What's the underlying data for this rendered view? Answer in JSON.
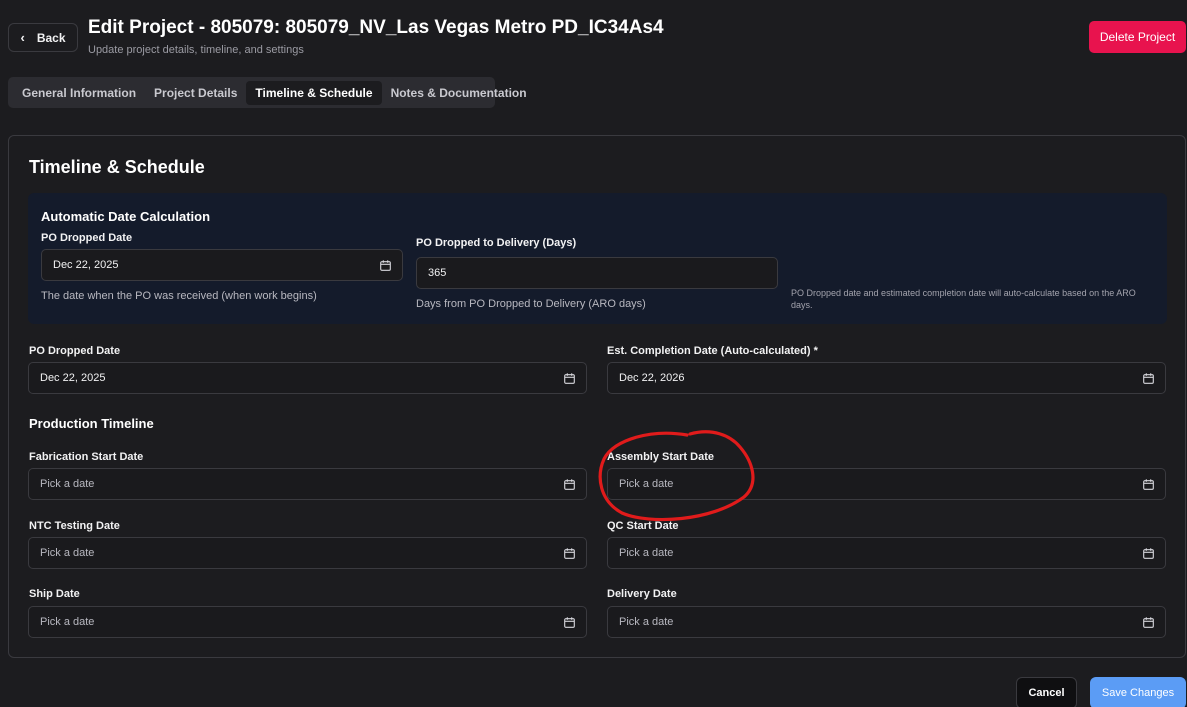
{
  "header": {
    "back_label": "Back",
    "title": "Edit Project - 805079: 805079_NV_Las Vegas Metro PD_IC34As4",
    "subtitle": "Update project details, timeline, and settings",
    "delete_label": "Delete Project"
  },
  "tabs": [
    {
      "label": "General Information",
      "active": false
    },
    {
      "label": "Project Details",
      "active": false
    },
    {
      "label": "Timeline & Schedule",
      "active": true
    },
    {
      "label": "Notes & Documentation",
      "active": false
    }
  ],
  "card": {
    "title": "Timeline & Schedule",
    "auto_calc": {
      "title": "Automatic Date Calculation",
      "po_dropped_label": "PO Dropped Date",
      "po_dropped_value": "Dec 22, 2025",
      "po_dropped_hint": "The date when the PO was received (when work begins)",
      "delivery_days_label": "PO Dropped to Delivery (Days)",
      "delivery_days_value": "365",
      "delivery_days_hint": "Days from PO Dropped to Delivery (ARO days)",
      "note": "PO Dropped date and estimated completion date will auto-calculate based on the ARO days."
    },
    "po_dropped": {
      "label": "PO Dropped Date",
      "value": "Dec 22, 2025"
    },
    "est_completion": {
      "label": "Est. Completion Date (Auto-calculated) *",
      "value": "Dec 22, 2026"
    },
    "production": {
      "title": "Production Timeline",
      "fabrication": {
        "label": "Fabrication Start Date",
        "placeholder": "Pick a date"
      },
      "assembly": {
        "label": "Assembly Start Date",
        "placeholder": "Pick a date"
      },
      "ntc": {
        "label": "NTC Testing Date",
        "placeholder": "Pick a date"
      },
      "qc": {
        "label": "QC Start Date",
        "placeholder": "Pick a date"
      },
      "ship": {
        "label": "Ship Date",
        "placeholder": "Pick a date"
      },
      "delivery": {
        "label": "Delivery Date",
        "placeholder": "Pick a date"
      }
    }
  },
  "footer": {
    "cancel_label": "Cancel",
    "save_label": "Save Changes"
  },
  "colors": {
    "background": "#1c1c1f",
    "delete": "#e8134e",
    "save": "#5b9cf5",
    "auto_box": "#141b2b",
    "annotation": "#e01b1b"
  },
  "icons": {
    "back": "chevron-left-icon",
    "date_field": "calendar-icon"
  }
}
